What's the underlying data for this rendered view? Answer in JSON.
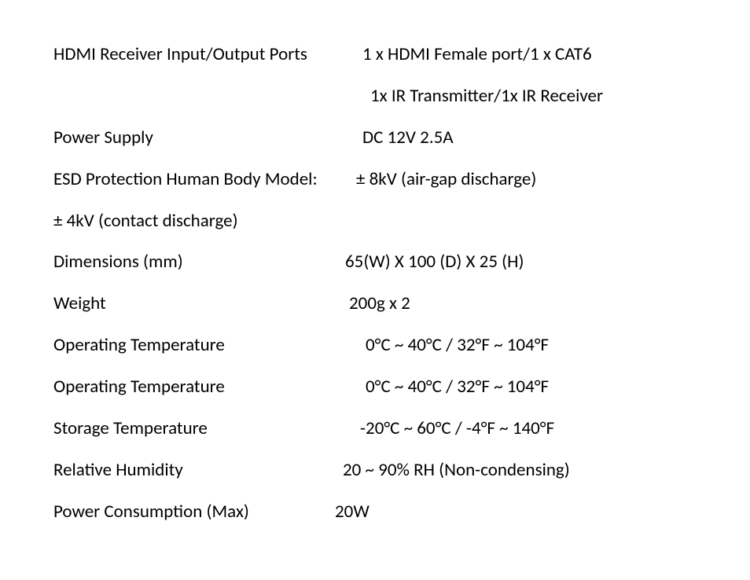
{
  "specs": {
    "r0": {
      "label": "HDMI Receiver Input/Output Ports",
      "value": "1 x HDMI Female port/1 x CAT6"
    },
    "r0b": {
      "value": "1x IR Transmitter/1x IR Receiver"
    },
    "r1": {
      "label": "Power Supply",
      "value": "DC 12V 2.5A"
    },
    "r2": {
      "label": "ESD Protection Human Body Model:",
      "value": "± 8kV (air-gap discharge)"
    },
    "r2b": {
      "label": "± 4kV (contact discharge)"
    },
    "r3": {
      "label": "Dimensions (mm)",
      "value": "65(W) X 100 (D) X 25 (H)"
    },
    "r4": {
      "label": "Weight",
      "value": "200g x 2"
    },
    "r5": {
      "label": "Operating Temperature",
      "value": "0°C ~ 40°C / 32°F ~ 104°F"
    },
    "r6": {
      "label": "Operating Temperature",
      "value": "0°C ~ 40°C / 32°F ~ 104°F"
    },
    "r7": {
      "label": "Storage Temperature",
      "value": "-20°C ~ 60°C / -4°F ~ 140°F"
    },
    "r8": {
      "label": "Relative Humidity",
      "value": "20 ~ 90% RH (Non-condensing)"
    },
    "r9": {
      "label": "Power Consumption (Max)",
      "value": "20W"
    }
  }
}
